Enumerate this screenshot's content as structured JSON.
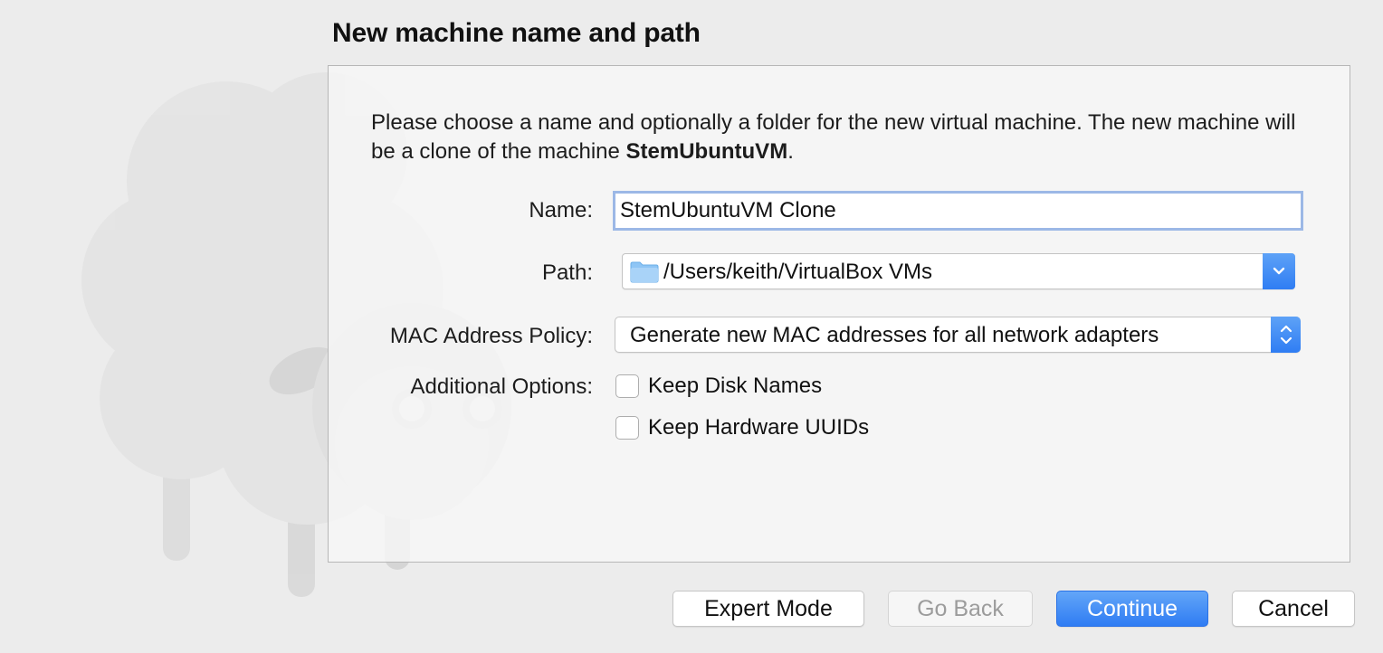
{
  "wizard": {
    "title": "New machine name and path",
    "description_prefix": "Please choose a name and optionally a folder for the new virtual machine. The new machine will be a clone of the machine ",
    "source_machine": "StemUbuntuVM",
    "description_suffix": "."
  },
  "form": {
    "name_label": "Name:",
    "name_value": "StemUbuntuVM Clone",
    "path_label": "Path:",
    "path_value": "/Users/keith/VirtualBox VMs",
    "mac_policy_label": "MAC Address Policy:",
    "mac_policy_value": "Generate new MAC addresses for all network adapters",
    "additional_options_label": "Additional Options:",
    "options": [
      {
        "label": "Keep Disk Names",
        "checked": false
      },
      {
        "label": "Keep Hardware UUIDs",
        "checked": false
      }
    ]
  },
  "buttons": {
    "expert_mode": "Expert Mode",
    "go_back": "Go Back",
    "continue": "Continue",
    "cancel": "Cancel"
  },
  "colors": {
    "accent": "#2f7df3",
    "background": "#ececec",
    "panel": "#f7f7f7",
    "focus_ring": "#9cb8e6",
    "disabled_text": "#9c9c9c"
  },
  "icons": [
    "sheep-watermark-icon",
    "folder-icon",
    "chevron-down-icon",
    "up-down-chevron-icon"
  ]
}
